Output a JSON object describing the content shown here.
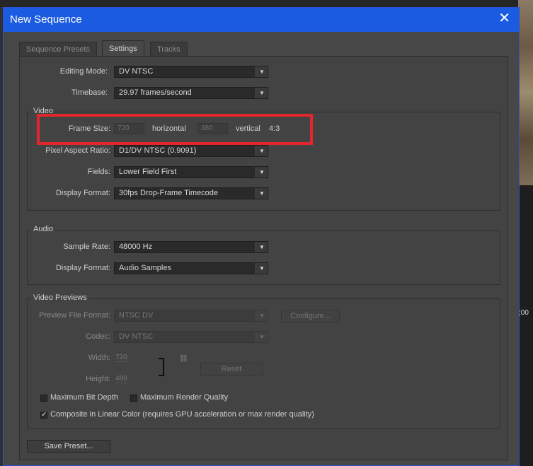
{
  "dialog": {
    "title": "New Sequence",
    "close_glyph": "✕"
  },
  "tabs": [
    {
      "label": "Sequence Presets"
    },
    {
      "label": "Settings"
    },
    {
      "label": "Tracks"
    }
  ],
  "general": {
    "editing_mode_label": "Editing Mode:",
    "editing_mode_value": "DV NTSC",
    "timebase_label": "Timebase:",
    "timebase_value": "29.97 frames/second"
  },
  "video": {
    "group_title": "Video",
    "frame_size_label": "Frame Size:",
    "width_value": "720",
    "horizontal_label": "horizontal",
    "height_value": "480",
    "vertical_label": "vertical",
    "aspect": "4:3",
    "par_label": "Pixel Aspect Ratio:",
    "par_value": "D1/DV NTSC (0.9091)",
    "fields_label": "Fields:",
    "fields_value": "Lower Field First",
    "display_format_label": "Display Format:",
    "display_format_value": "30fps Drop-Frame Timecode"
  },
  "audio": {
    "group_title": "Audio",
    "sample_rate_label": "Sample Rate:",
    "sample_rate_value": "48000 Hz",
    "display_format_label": "Display Format:",
    "display_format_value": "Audio Samples"
  },
  "previews": {
    "group_title": "Video Previews",
    "file_format_label": "Preview File Format:",
    "file_format_value": "NTSC DV",
    "configure_label": "Configure...",
    "codec_label": "Codec:",
    "codec_value": "DV NTSC",
    "width_label": "Width:",
    "width_value": "720",
    "height_label": "Height:",
    "height_value": "480",
    "reset_label": "Reset",
    "max_bit_depth_label": "Maximum Bit Depth",
    "max_render_quality_label": "Maximum Render Quality",
    "composite_label": "Composite in Linear Color (requires GPU acceleration or max render quality)",
    "check_glyph": "✓"
  },
  "footer": {
    "save_preset_label": "Save Preset..."
  },
  "background": {
    "timecode": ";00"
  },
  "colors": {
    "titlebar": "#1b5be1",
    "highlight": "#e2262c"
  }
}
